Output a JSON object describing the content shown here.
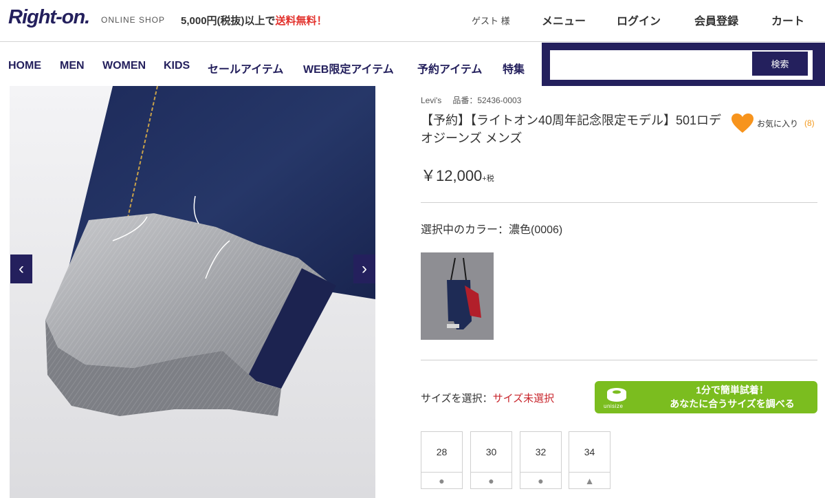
{
  "header": {
    "logo": "Right-on.",
    "logo_sub": "ONLINE SHOP",
    "shipping_prefix": "5,000円(税抜)以上で",
    "shipping_free": "送料無料！",
    "guest": "ゲスト 様",
    "menu": "メニュー",
    "login": "ログイン",
    "register": "会員登録",
    "cart": "カート"
  },
  "nav": {
    "items": [
      "HOME",
      "MEN",
      "WOMEN",
      "KIDS",
      "セールアイテム",
      "WEB限定アイテム",
      "予約アイテム",
      "特集"
    ],
    "search_button": "検索",
    "search_placeholder": ""
  },
  "gallery": {
    "prev": "‹",
    "next": "›"
  },
  "product": {
    "brand": "Levi's",
    "code": "品番：52436-0003",
    "title": "【予約】【ライトオン40周年記念限定モデル】501ロデオジーンズ メンズ",
    "favorite_label": "お気に入り",
    "favorite_count": "(8)",
    "price": "￥12,000",
    "tax": "+税",
    "color_label": "選択中のカラー：濃色(0006)",
    "size_label": "サイズを選択：",
    "size_status": "サイズ未選択",
    "unisize_line1": "1分で簡単試着！",
    "unisize_line2": "あなたに合うサイズを調べる",
    "unisize_logo": "unisize",
    "sizes": [
      {
        "size": "28",
        "stock": "●"
      },
      {
        "size": "30",
        "stock": "●"
      },
      {
        "size": "32",
        "stock": "●"
      },
      {
        "size": "34",
        "stock": "▲"
      }
    ]
  },
  "colors": {
    "brand_navy": "#24205d",
    "accent_green": "#7bbd1f",
    "favorite_orange": "#f7941d",
    "alert_red": "#c8252c"
  }
}
